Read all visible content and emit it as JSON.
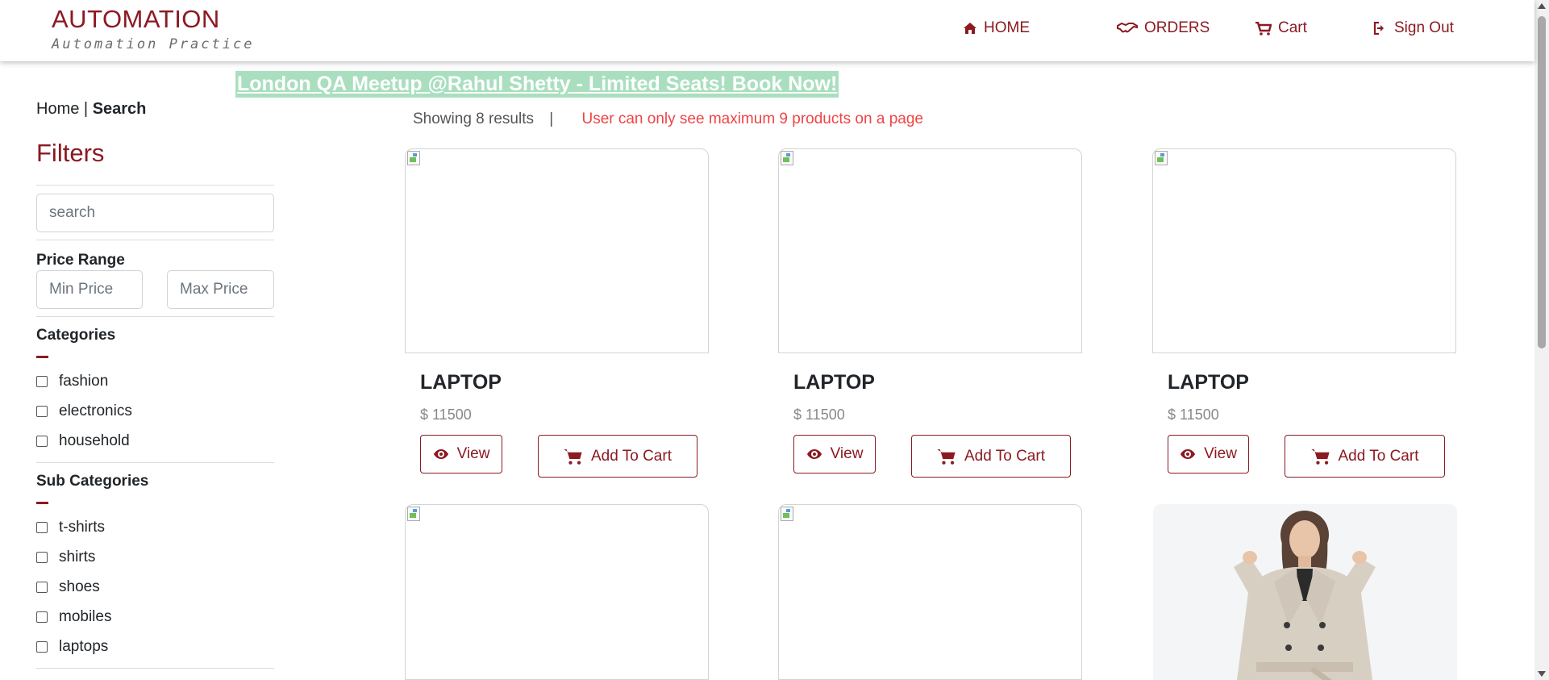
{
  "header": {
    "logo_title": "AUTOMATION",
    "logo_subtitle": "Automation Practice",
    "nav": {
      "home": "HOME",
      "orders": "ORDERS",
      "cart": "Cart",
      "sign_out": "Sign Out"
    }
  },
  "banner": "London QA Meetup @Rahul Shetty - Limited Seats! Book Now!",
  "breadcrumb": {
    "home": "Home",
    "separator": "|",
    "current": "Search"
  },
  "filters": {
    "title": "Filters",
    "search_placeholder": "search",
    "price_range_label": "Price Range",
    "min_price_placeholder": "Min Price",
    "max_price_placeholder": "Max Price",
    "categories_label": "Categories",
    "categories": [
      "fashion",
      "electronics",
      "household"
    ],
    "sub_categories_label": "Sub Categories",
    "sub_categories": [
      "t-shirts",
      "shirts",
      "shoes",
      "mobiles",
      "laptops"
    ]
  },
  "results": {
    "showing": "Showing 8 results",
    "separator": "|",
    "warning": "User can only see maximum 9 products on a page"
  },
  "products": [
    {
      "name": "LAPTOP",
      "price": "$ 11500",
      "view_label": "View",
      "add_label": "Add To Cart"
    },
    {
      "name": "LAPTOP",
      "price": "$ 11500",
      "view_label": "View",
      "add_label": "Add To Cart"
    },
    {
      "name": "LAPTOP",
      "price": "$ 11500",
      "view_label": "View",
      "add_label": "Add To Cart"
    }
  ],
  "colors": {
    "brand": "#8b1a22",
    "warning": "#ef4444",
    "banner_bg": "#a9dfbf"
  },
  "icons": [
    "home-icon",
    "handshake-icon",
    "cart-icon",
    "sign-out-icon",
    "eye-icon",
    "broken-image-icon"
  ]
}
